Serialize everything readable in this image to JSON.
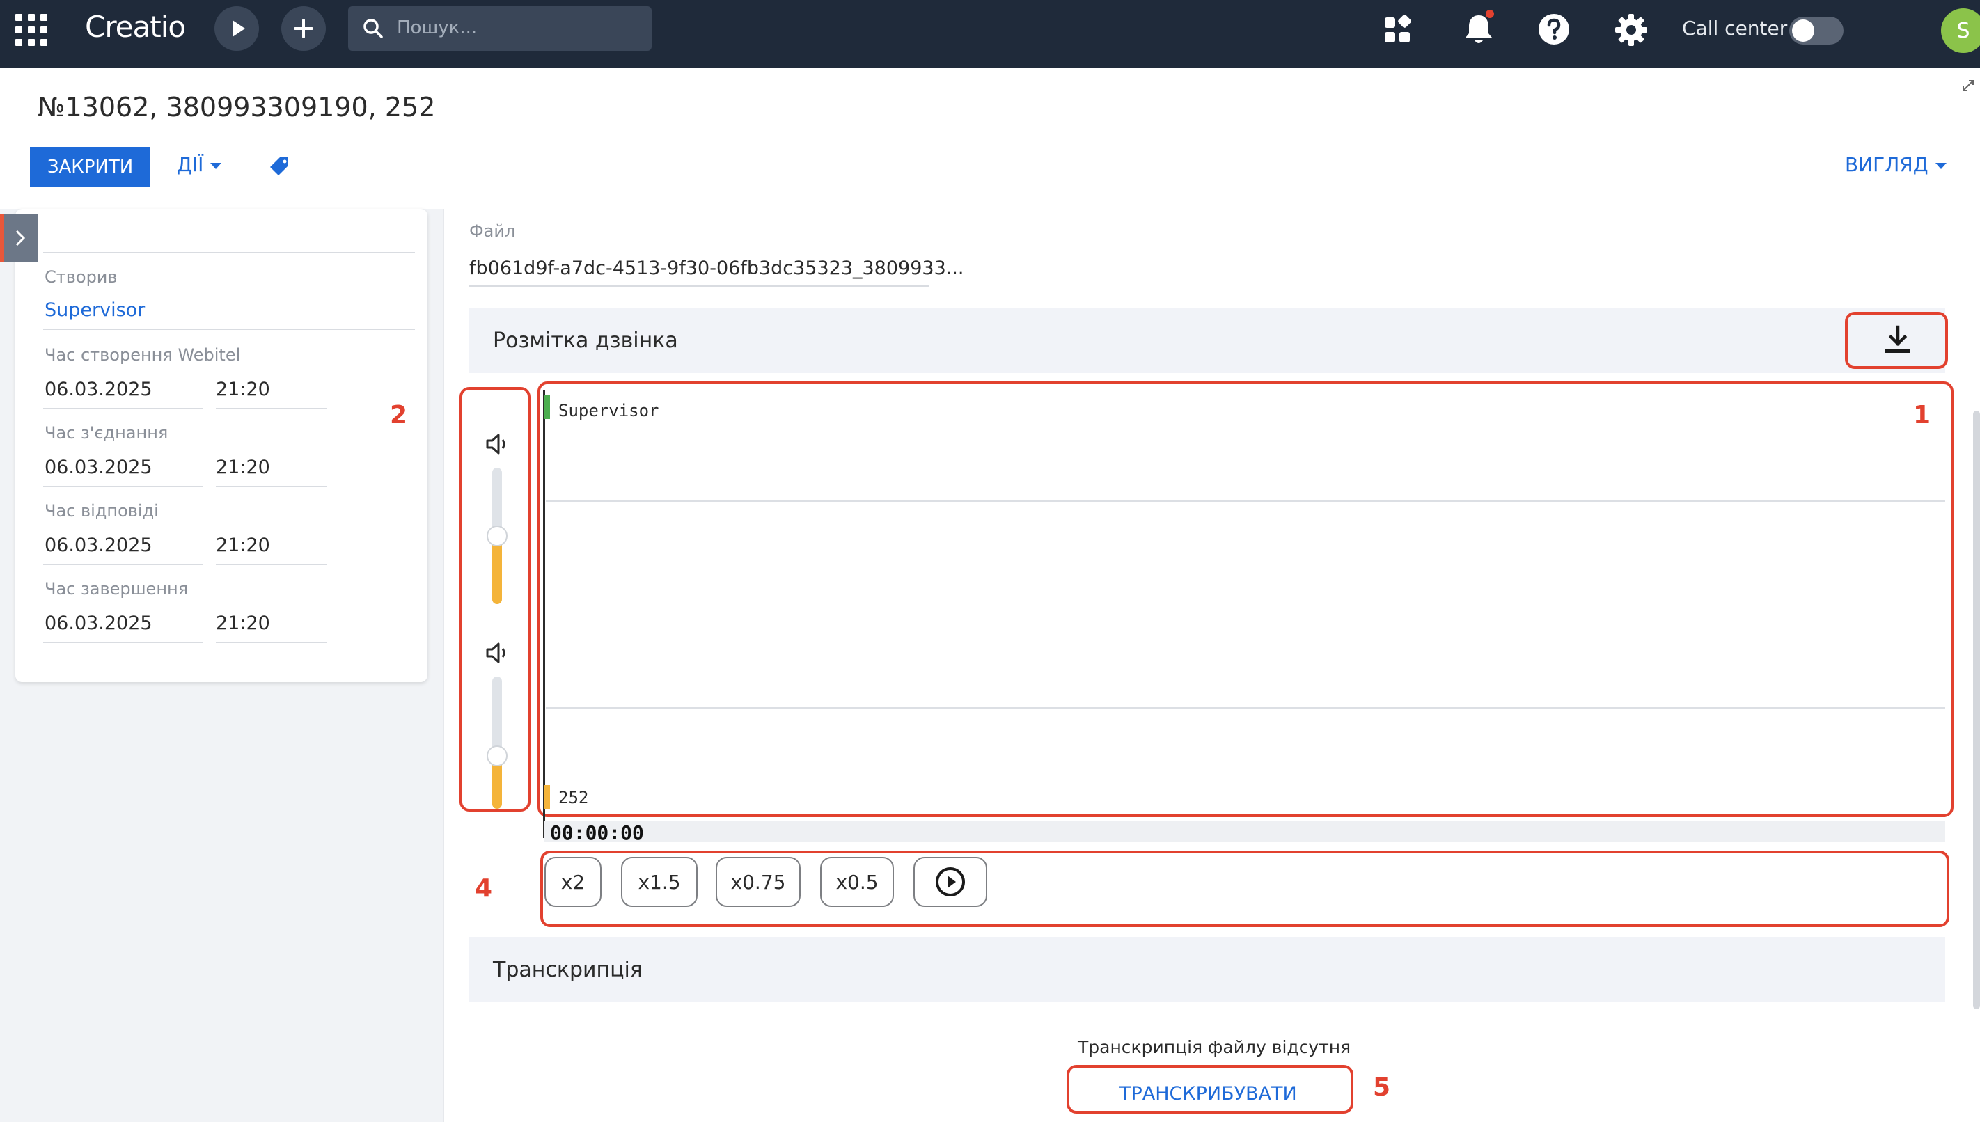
{
  "topbar": {
    "logo": "Creatio",
    "search_placeholder": "Пошук...",
    "call_center_label": "Call center",
    "avatar_initial": "S"
  },
  "header": {
    "title": "№13062, 380993309190, 252",
    "close_label": "ЗАКРИТИ",
    "actions_label": "ДІЇ",
    "view_label": "ВИГЛЯД"
  },
  "left_panel": {
    "created_by_label": "Створив",
    "created_by_value": "Supervisor",
    "fields": [
      {
        "label": "Час створення Webitel",
        "date": "06.03.2025",
        "time": "21:20"
      },
      {
        "label": "Час з'єднання",
        "date": "06.03.2025",
        "time": "21:20"
      },
      {
        "label": "Час відповіді",
        "date": "06.03.2025",
        "time": "21:20"
      },
      {
        "label": "Час завершення",
        "date": "06.03.2025",
        "time": "21:20"
      }
    ]
  },
  "file": {
    "label": "Файл",
    "value": "fb061d9f-a7dc-4513-9f30-06fb3dc35323_3809933..."
  },
  "call_markup": {
    "title": "Розмітка дзвінка",
    "channel_top": "Supervisor",
    "channel_bottom": "252",
    "timecode": "00:00:00",
    "volume_top": 0.5,
    "volume_bottom": 0.4
  },
  "speed_buttons": [
    "x2",
    "x1.5",
    "x0.75",
    "x0.5"
  ],
  "transcription": {
    "title": "Транскрипція",
    "empty_text": "Транскрипція файлу відсутня",
    "button_label": "ТРАНСКРИБУВАТИ"
  },
  "markers": {
    "m1": "1",
    "m2": "2",
    "m4": "4",
    "m5": "5"
  },
  "colors": {
    "accent": "#1e6ad8",
    "topbar": "#1f2a3a",
    "highlight": "#e2412f",
    "channel_top": "#4caf50",
    "channel_bottom": "#f4b43a"
  }
}
